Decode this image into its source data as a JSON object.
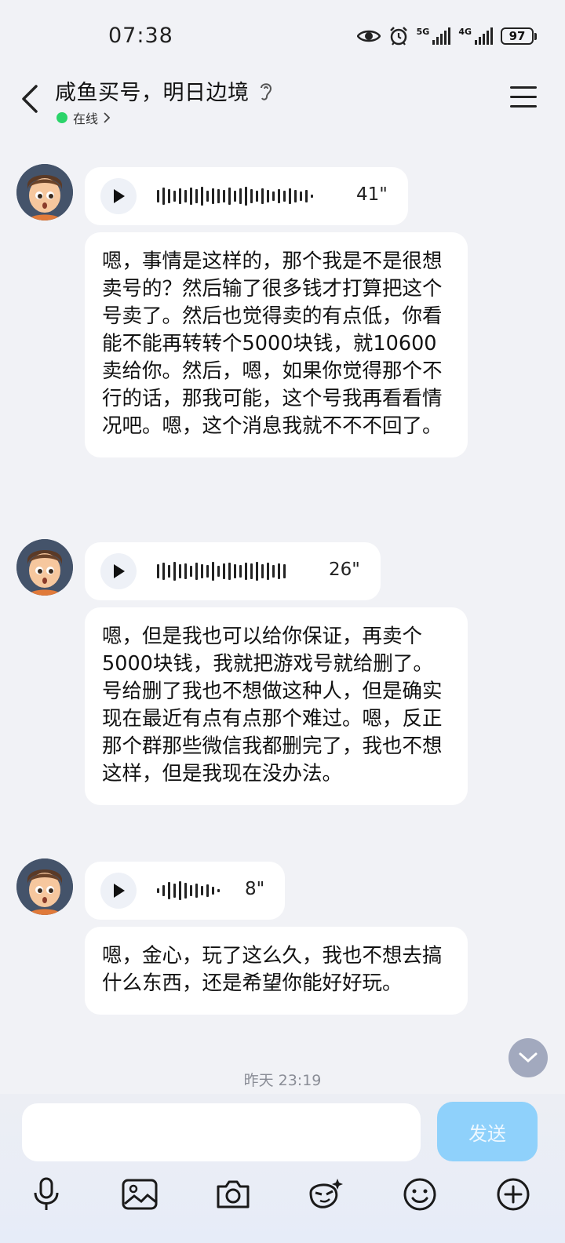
{
  "status": {
    "time": "07:38",
    "net1": "5G",
    "net2": "4G",
    "battery": "97"
  },
  "header": {
    "title": "咸鱼买号，明日边境",
    "online": "在线"
  },
  "messages": [
    {
      "duration": "41\"",
      "text": "嗯，事情是这样的，那个我是不是很想卖号的？然后输了很多钱才打算把这个号卖了。然后也觉得卖的有点低，你看能不能再转转个5000块钱，就10600卖给你。然后，嗯，如果你觉得那个不行的话，那我可能，这个号我再看看情况吧。嗯，这个消息我就不不不回了。"
    },
    {
      "duration": "26\"",
      "text": "嗯，但是我也可以给你保证，再卖个5000块钱，我就把游戏号就给删了。号给删了我也不想做这种人，但是确实现在最近有点有点那个难过。嗯，反正那个群那些微信我都删完了，我也不想这样，但是我现在没办法。"
    },
    {
      "duration": "8\"",
      "text": "嗯，金心，玩了这么久，我也不想去搞什么东西，还是希望你能好好玩。"
    }
  ],
  "timestamp": "昨天 23:19",
  "composer": {
    "placeholder": "",
    "send_label": "发送"
  },
  "colors": {
    "online": "#2bd46a",
    "send": "#8fd1fb",
    "background": "#f1f2f6"
  }
}
